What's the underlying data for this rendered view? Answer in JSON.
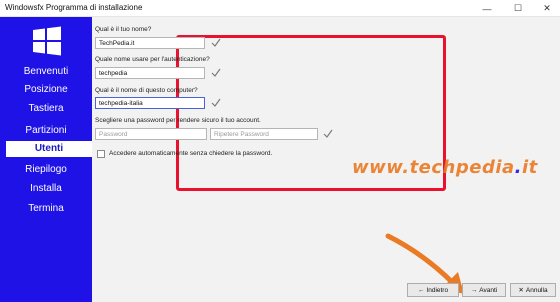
{
  "window": {
    "title": "Windowsfx Programma di installazione",
    "min_icon": "—",
    "max_icon": "☐",
    "close_icon": "✕"
  },
  "sidebar": {
    "items": [
      {
        "label": "Benvenuti"
      },
      {
        "label": "Posizione"
      },
      {
        "label": "Tastiera"
      },
      {
        "label": "Partizioni"
      },
      {
        "label": "Utenti"
      },
      {
        "label": "Riepilogo"
      },
      {
        "label": "Installa"
      },
      {
        "label": "Termina"
      }
    ],
    "active": "Utenti"
  },
  "form": {
    "name_label": "Qual è il tuo nome?",
    "name_value": "TechPedia.it",
    "username_label": "Quale nome usare per l'autenticazione?",
    "username_value": "techpedia",
    "computer_label": "Qual è il nome di questo computer?",
    "computer_value": "techpedia-italia",
    "password_label": "Scegliere una password per rendere sicuro il tuo account.",
    "password_placeholder": "Password",
    "repeat_placeholder": "Ripetere Password",
    "autologin_label": "Accedere automaticamente senza chiedere la password."
  },
  "watermark": {
    "pre": "www.",
    "brand": "techpedia",
    "dot": ".",
    "tld": "it"
  },
  "buttons": {
    "back": "Indietro",
    "back_icon": "←",
    "next": "Avanti",
    "next_icon": "→",
    "cancel": "Annulla",
    "cancel_icon": "✕"
  },
  "colors": {
    "sidebar": "#1f12e6",
    "highlight": "#e8122e",
    "annotation": "#ea7a23"
  }
}
